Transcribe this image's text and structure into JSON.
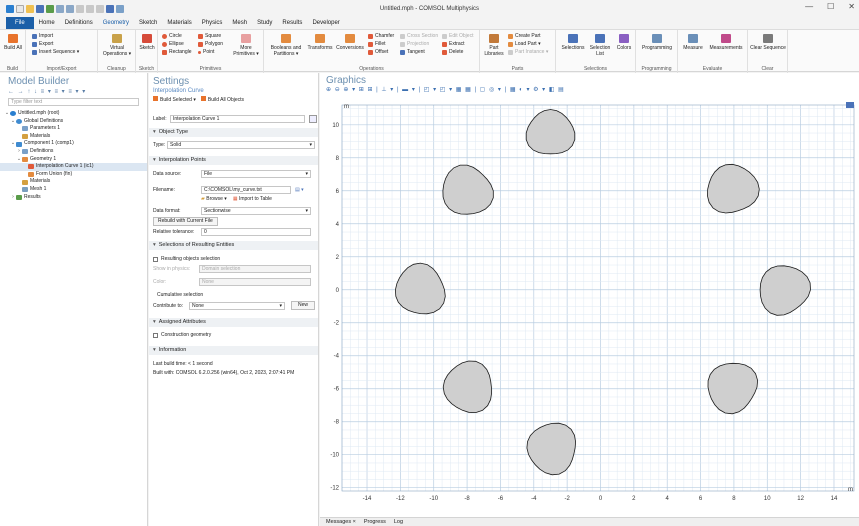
{
  "window": {
    "title": "Untitled.mph - COMSOL Multiphysics",
    "controls": [
      "—",
      "☐",
      "✕"
    ]
  },
  "menu": [
    "File",
    "Home",
    "Definitions",
    "Geometry",
    "Sketch",
    "Materials",
    "Physics",
    "Mesh",
    "Study",
    "Results",
    "Developer"
  ],
  "ribbon": {
    "groups": [
      {
        "label": "Build",
        "items": [
          "Build All"
        ]
      },
      {
        "label": "Import/Export",
        "items": [
          "Import",
          "Export",
          "Insert Sequence ▾"
        ]
      },
      {
        "label": "Cleanup",
        "items": [
          "Virtual Operations ▾"
        ]
      },
      {
        "label": "Sketch",
        "items": [
          "Sketch"
        ]
      },
      {
        "label": "Primitives",
        "items": [
          "Circle",
          "Ellipse",
          "Rectangle",
          "Square",
          "Polygon",
          "Point",
          "More Primitives ▾"
        ]
      },
      {
        "label": "Operations",
        "items": [
          "Booleans and Partitions ▾",
          "Transforms",
          "Conversions",
          "Chamfer",
          "Fillet",
          "Offset",
          "Cross Section",
          "Projection",
          "Tangent",
          "Edit Object",
          "Extract",
          "Delete"
        ]
      },
      {
        "label": "Parts",
        "items": [
          "Part Libraries",
          "Create Part",
          "Load Part ▾",
          "Part Instance ▾"
        ]
      },
      {
        "label": "Selections",
        "items": [
          "Selections",
          "Selection List",
          "Colors"
        ]
      },
      {
        "label": "Programming",
        "items": [
          "Programming"
        ]
      },
      {
        "label": "Evaluate",
        "items": [
          "Measure",
          "Measurements"
        ]
      },
      {
        "label": "Clear",
        "items": [
          "Clear Sequence"
        ]
      }
    ]
  },
  "model_builder": {
    "title": "Model Builder",
    "filter_placeholder": "Type filter text",
    "tree": [
      {
        "label": "Untitled.mph (root)",
        "level": 0
      },
      {
        "label": "Global Definitions",
        "level": 1
      },
      {
        "label": "Parameters 1",
        "level": 2
      },
      {
        "label": "Materials",
        "level": 2
      },
      {
        "label": "Component 1 (comp1)",
        "level": 1
      },
      {
        "label": "Definitions",
        "level": 2
      },
      {
        "label": "Geometry 1",
        "level": 2
      },
      {
        "label": "Interpolation Curve 1 (ic1)",
        "level": 3,
        "selected": true
      },
      {
        "label": "Form Union (fin)",
        "level": 3
      },
      {
        "label": "Materials",
        "level": 2
      },
      {
        "label": "Mesh 1",
        "level": 2
      },
      {
        "label": "Results",
        "level": 1
      }
    ]
  },
  "settings": {
    "title": "Settings",
    "subtitle": "Interpolation Curve",
    "build_selected": "Build Selected ▾",
    "build_all": "Build All Objects",
    "label_caption": "Label:",
    "label_value": "Interpolation Curve 1",
    "object_type_header": "Object Type",
    "type_caption": "Type:",
    "type_value": "Solid",
    "interp_header": "Interpolation Points",
    "datasource_caption": "Data source:",
    "datasource_value": "File",
    "filename_caption": "Filename:",
    "filename_value": "C:\\COMSOL\\my_curve.txt",
    "browse": "Browse ▾",
    "import_table": "Import to Table",
    "dataformat_caption": "Data format:",
    "dataformat_value": "Sectionwise",
    "rebuild": "Rebuild with Current File",
    "reltol_caption": "Relative tolerance:",
    "reltol_value": "0",
    "sel_header": "Selections of Resulting Entities",
    "resulting_sel": "Resulting objects selection",
    "show_physics_caption": "Show in physics:",
    "show_physics_value": "Domain selection",
    "color_caption": "Color:",
    "color_value": "None",
    "cumulative": "Cumulative selection",
    "contribute_caption": "Contribute to:",
    "contribute_value": "None",
    "new_btn": "New",
    "assigned_header": "Assigned Attributes",
    "construction": "Construction geometry",
    "info_header": "Information",
    "build_time": "Last build time:  < 1 second",
    "built_with": "Built with:  COMSOL 6.2.0.256 (win64), Oct 2, 2023, 2:07:41 PM"
  },
  "graphics": {
    "title": "Graphics",
    "axis_unit": "m",
    "x_ticks": [
      "-14",
      "-12",
      "-10",
      "-8",
      "-6",
      "-4",
      "-2",
      "0",
      "2",
      "4",
      "6",
      "8",
      "10",
      "12",
      "14"
    ],
    "y_ticks": [
      "10",
      "8",
      "6",
      "4",
      "2",
      "0",
      "-2",
      "-4",
      "-6",
      "-8",
      "-10",
      "-12"
    ],
    "shape_count": 8,
    "bottom_tabs": [
      "Messages ×",
      "Progress",
      "Log"
    ]
  },
  "chart_data": {
    "type": "scatter",
    "xlim": [
      -15.5,
      15.2
    ],
    "ylim": [
      -12.2,
      11.2
    ],
    "grid": true,
    "shapes": [
      {
        "cx": -3,
        "cy": 9.5,
        "r": 1.4
      },
      {
        "cx": 7.9,
        "cy": 6.1,
        "r": 1.5
      },
      {
        "cx": 11,
        "cy": 0,
        "r": 1.5
      },
      {
        "cx": 7.9,
        "cy": -5.9,
        "r": 1.5
      },
      {
        "cx": -2.9,
        "cy": -9.6,
        "r": 1.5
      },
      {
        "cx": -7.9,
        "cy": -5.9,
        "r": 1.5
      },
      {
        "cx": -10.8,
        "cy": 0,
        "r": 1.5
      },
      {
        "cx": -8,
        "cy": 6,
        "r": 1.5
      }
    ]
  },
  "colors": {
    "accent": "#1b5fa8",
    "shape_fill": "#cfcfcf",
    "grid_minor": "#dfe9f3",
    "grid_major": "#b9cde1"
  }
}
